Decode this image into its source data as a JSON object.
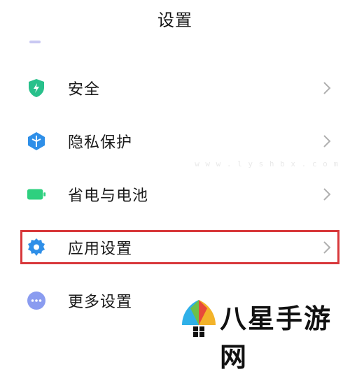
{
  "header": {
    "title": "设置"
  },
  "items": [
    {
      "label": "安全",
      "icon": "shield-icon",
      "color": "#28c08b"
    },
    {
      "label": "隐私保护",
      "icon": "privacy-icon",
      "color": "#2f8fe8"
    },
    {
      "label": "省电与电池",
      "icon": "battery-icon",
      "color": "#2ed07f"
    },
    {
      "label": "应用设置",
      "icon": "gear-icon",
      "color": "#2f8fe8"
    },
    {
      "label": "更多设置",
      "icon": "more-icon",
      "color": "#8a9cf0"
    }
  ],
  "highlight": {
    "color": "#d8383b",
    "target": "应用设置"
  },
  "watermark": {
    "url": "w w w . l y s h b x . c o m",
    "brand": "八星手游网"
  }
}
